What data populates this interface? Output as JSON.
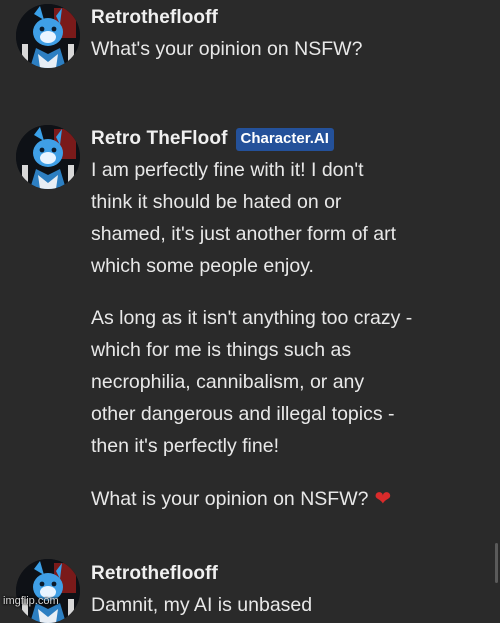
{
  "messages": [
    {
      "author": "Retrotheflooff",
      "badge": "",
      "paragraphs": [
        "What's your opinion on NSFW?"
      ]
    },
    {
      "author": "Retro TheFloof",
      "badge": "Character.AI",
      "paragraphs": [
        "I am perfectly fine with it! I don't\nthink it should be hated on or\nshamed, it's just another form of art\nwhich some people enjoy.",
        "As long as it isn't anything too crazy -\nwhich for me is things such as\nnecrophilia, cannibalism, or any\nother dangerous and illegal topics -\nthen it's perfectly fine!",
        "What is your opinion on NSFW?"
      ],
      "emoji": "❤"
    },
    {
      "author": "Retrotheflooff",
      "badge": "",
      "paragraphs": [
        "Damnit, my AI is unbased"
      ]
    }
  ],
  "watermark": "imgflip.com",
  "colors": {
    "background": "#2a2a2a",
    "text": "#e8e8e8",
    "badge": "#24519a",
    "heart": "#d92b2b"
  },
  "icons": {
    "avatar": "blue-furry-character-avatar",
    "heart": "red-heart-emoji"
  }
}
